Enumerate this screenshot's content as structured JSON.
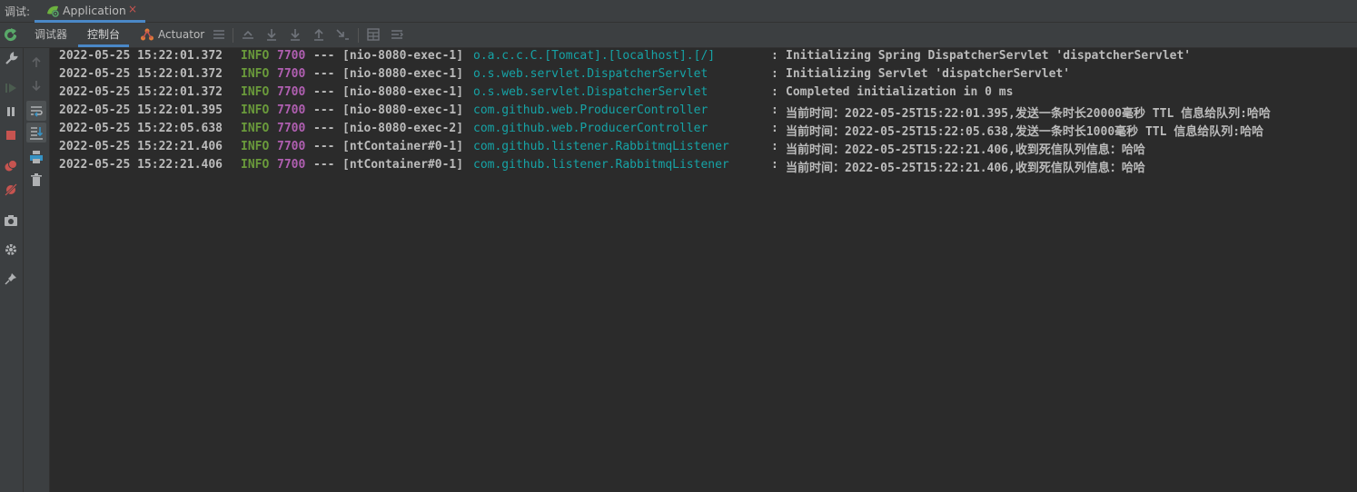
{
  "topbar": {
    "debug_label": "调试:",
    "app_tab": {
      "title": "Application",
      "close": "×"
    }
  },
  "toolbar": {
    "tabs": [
      {
        "label": "调试器"
      },
      {
        "label": "控制台"
      },
      {
        "label": "Actuator"
      }
    ]
  },
  "console": {
    "lines": [
      {
        "date": "2022-05-25 15:22:01.372",
        "level": "INFO",
        "pid": "7700",
        "sep": "---",
        "thread": "[nio-8080-exec-1]",
        "logger": "o.a.c.c.C.[Tomcat].[localhost].[/]",
        "colon": ":",
        "message": "Initializing Spring DispatcherServlet 'dispatcherServlet'"
      },
      {
        "date": "2022-05-25 15:22:01.372",
        "level": "INFO",
        "pid": "7700",
        "sep": "---",
        "thread": "[nio-8080-exec-1]",
        "logger": "o.s.web.servlet.DispatcherServlet",
        "colon": ":",
        "message": "Initializing Servlet 'dispatcherServlet'"
      },
      {
        "date": "2022-05-25 15:22:01.372",
        "level": "INFO",
        "pid": "7700",
        "sep": "---",
        "thread": "[nio-8080-exec-1]",
        "logger": "o.s.web.servlet.DispatcherServlet",
        "colon": ":",
        "message": "Completed initialization in 0 ms"
      },
      {
        "date": "2022-05-25 15:22:01.395",
        "level": "INFO",
        "pid": "7700",
        "sep": "---",
        "thread": "[nio-8080-exec-1]",
        "logger": "com.github.web.ProducerController",
        "colon": ":",
        "message": "当前时间：2022-05-25T15:22:01.395,发送一条时长20000毫秒 TTL 信息给队列:哈哈"
      },
      {
        "date": "2022-05-25 15:22:05.638",
        "level": "INFO",
        "pid": "7700",
        "sep": "---",
        "thread": "[nio-8080-exec-2]",
        "logger": "com.github.web.ProducerController",
        "colon": ":",
        "message": "当前时间：2022-05-25T15:22:05.638,发送一条时长1000毫秒 TTL 信息给队列:哈哈"
      },
      {
        "date": "2022-05-25 15:22:21.406",
        "level": "INFO",
        "pid": "7700",
        "sep": "---",
        "thread": "[ntContainer#0-1]",
        "logger": "com.github.listener.RabbitmqListener",
        "colon": ":",
        "message": "当前时间：2022-05-25T15:22:21.406,收到死信队列信息：哈哈"
      },
      {
        "date": "2022-05-25 15:22:21.406",
        "level": "INFO",
        "pid": "7700",
        "sep": "---",
        "thread": "[ntContainer#0-1]",
        "logger": "com.github.listener.RabbitmqListener",
        "colon": ":",
        "message": "当前时间：2022-05-25T15:22:21.406,收到死信队列信息：哈哈"
      }
    ]
  },
  "icons": {
    "top_toolbar": [
      "rerun-icon",
      "actuator-icon",
      "menu-icon",
      "show-execution-point-icon",
      "step-over-icon",
      "step-into-icon",
      "force-step-into-icon",
      "step-out-icon",
      "run-to-cursor-icon",
      "evaluate-icon",
      "trace-icon"
    ],
    "left_outer": [
      "rerun-icon",
      "wrench-icon",
      "resume-icon",
      "pause-icon",
      "stop-icon",
      "view-breakpoints-icon",
      "mute-breakpoints-icon",
      "camera-icon",
      "settings-icon",
      "pin-icon"
    ],
    "left_inner": [
      "up-arrow-icon",
      "down-arrow-icon",
      "soft-wrap-icon",
      "scroll-to-end-icon",
      "print-icon",
      "trash-icon"
    ]
  },
  "colors": {
    "background": "#2b2b2b",
    "panel": "#3c3f41",
    "info": "#6a9a3b",
    "pid": "#b05fb1",
    "logger": "#16a3a6",
    "text": "#bbbbbb",
    "accent": "#4a88c7"
  }
}
